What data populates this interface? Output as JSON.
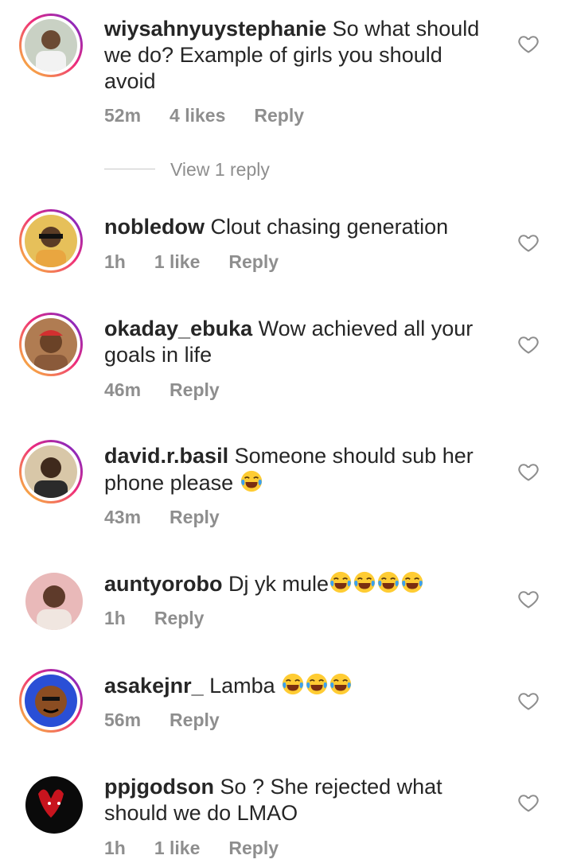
{
  "comments": [
    {
      "username": "wiysahnyuystephanie",
      "text": "So what should we do? Example of girls you should avoid",
      "time": "52m",
      "likes": "4 likes",
      "reply": "Reply",
      "replies_label": "View 1 reply",
      "avatar_ring": true
    },
    {
      "username": "nobledow",
      "text": "Clout chasing generation",
      "time": "1h",
      "likes": "1 like",
      "reply": "Reply",
      "avatar_ring": true
    },
    {
      "username": "okaday_ebuka",
      "text": "Wow achieved all your goals in life",
      "time": "46m",
      "reply": "Reply",
      "avatar_ring": true
    },
    {
      "username": "david.r.basil",
      "text": "Someone should sub her phone please",
      "time": "43m",
      "reply": "Reply",
      "avatar_ring": true
    },
    {
      "username": "auntyorobo",
      "text": "Dj yk mule",
      "time": "1h",
      "reply": "Reply",
      "avatar_ring": false
    },
    {
      "username": "asakejnr_",
      "text": "Lamba",
      "time": "56m",
      "reply": "Reply",
      "avatar_ring": true
    },
    {
      "username": "ppjgodson",
      "text": "So ? She rejected what should we do LMAO",
      "time": "1h",
      "likes": "1 like",
      "reply": "Reply",
      "avatar_ring": false
    }
  ],
  "icons": {
    "heart": "heart-outline-icon",
    "emoji": "face-with-tears-of-joy-emoji"
  },
  "colors": {
    "meta": "#8e8e8e",
    "text": "#262626",
    "ring_start": "#f9ce34",
    "ring_mid": "#ee2a7b",
    "ring_end": "#6228d7"
  }
}
